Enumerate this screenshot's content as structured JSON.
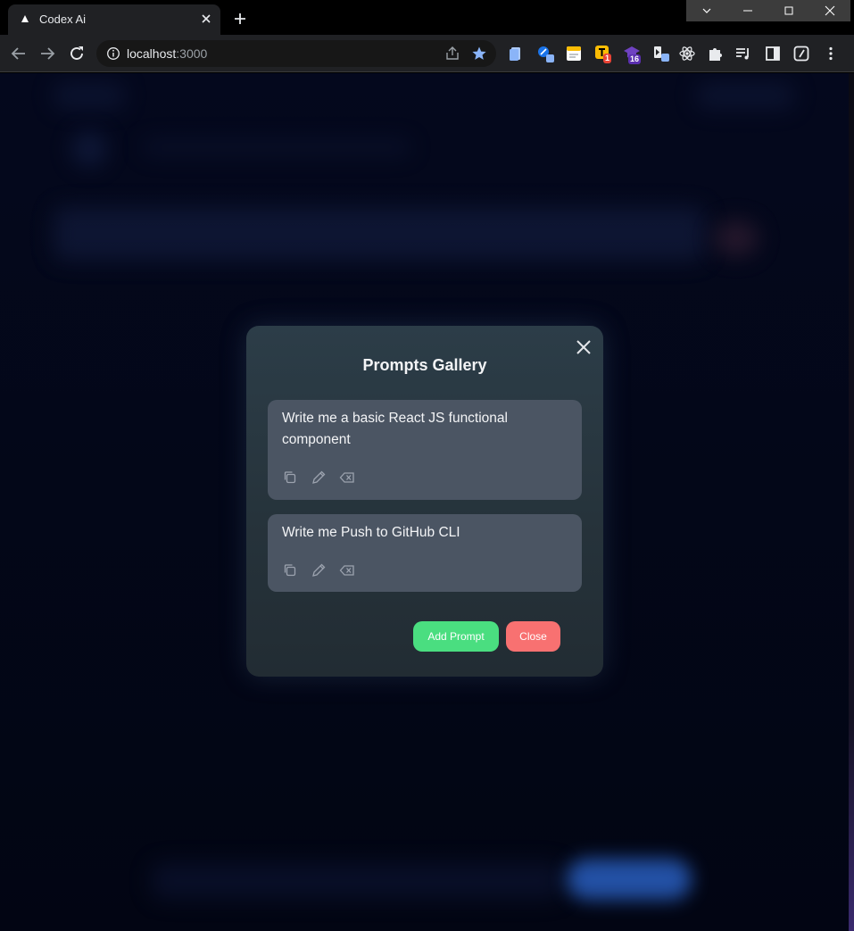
{
  "browser": {
    "tab_title": "Codex Ai",
    "url_host": "localhost",
    "url_port": ":3000",
    "extensions": [
      {
        "icon": "file-copy-icon"
      },
      {
        "icon": "picker-icon"
      },
      {
        "icon": "notes-icon"
      },
      {
        "icon": "t-extension-icon",
        "badge": "1"
      },
      {
        "icon": "graduation-cap-icon",
        "badge": "16"
      },
      {
        "icon": "cast-icon"
      },
      {
        "icon": "react-devtools-icon"
      },
      {
        "icon": "puzzle-icon"
      },
      {
        "icon": "media-queue-icon"
      },
      {
        "icon": "side-panel-icon"
      },
      {
        "icon": "clock-icon"
      },
      {
        "icon": "more-vert-icon"
      }
    ]
  },
  "colors": {
    "add_button": "#4ade80",
    "close_button": "#f87171",
    "card": "#4b5563",
    "modal": "#26333b",
    "page_bg": "#030718"
  },
  "modal": {
    "title": "Prompts Gallery",
    "prompts": [
      {
        "text": "Write me a basic React JS functional component"
      },
      {
        "text": "Write me Push to GitHub CLI"
      }
    ],
    "add_label": "Add Prompt",
    "close_label": "Close"
  }
}
